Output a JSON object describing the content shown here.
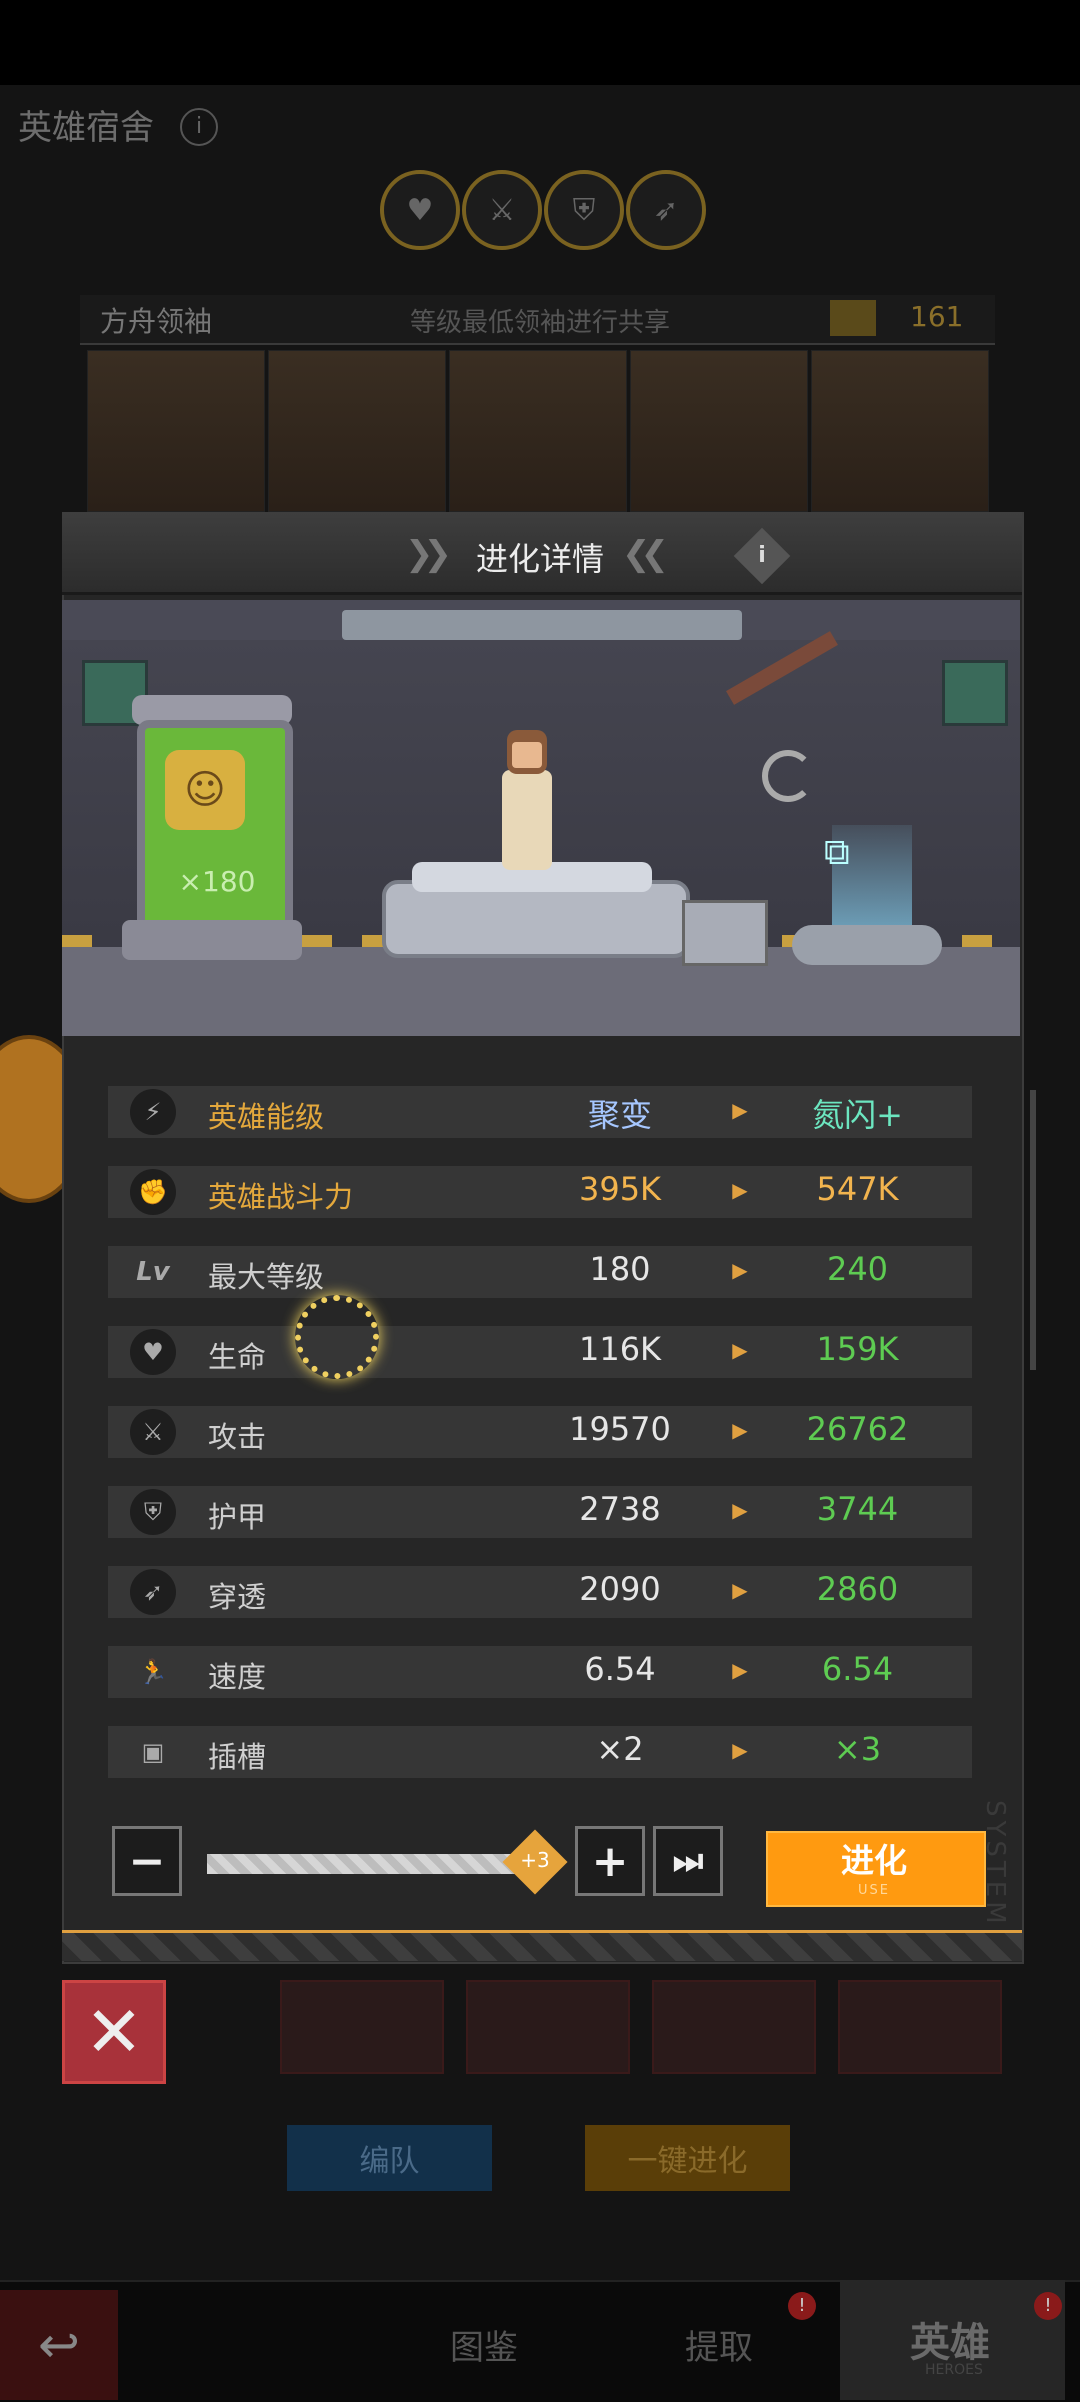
{
  "background": {
    "page_title": "英雄宿舍",
    "info_glyph": "i",
    "role_icons": [
      "heart-icon",
      "sword-icon",
      "shield-icon",
      "pierce-icon"
    ],
    "leader_label": "方舟领袖",
    "leader_desc": "等级最低领袖进行共享",
    "leader_level": "161",
    "team_button": "编队",
    "auto_evolve_button": "一键进化",
    "nav": {
      "codex": "图鉴",
      "extract": "提取",
      "heroes": "英雄",
      "heroes_sub": "HEROES",
      "badge": "!"
    }
  },
  "modal": {
    "title": "进化详情",
    "info_glyph": "i",
    "tube_count": "×180",
    "stats": [
      {
        "icon": "lightning-icon",
        "label": "英雄能级",
        "current": "聚变",
        "next": "氮闪+"
      },
      {
        "icon": "fist-icon",
        "label": "英雄战斗力",
        "current": "395K",
        "next": "547K"
      },
      {
        "icon": "level-icon",
        "label": "最大等级",
        "current": "180",
        "next": "240"
      },
      {
        "icon": "heart-icon",
        "label": "生命",
        "current": "116K",
        "next": "159K"
      },
      {
        "icon": "sword-icon",
        "label": "攻击",
        "current": "19570",
        "next": "26762"
      },
      {
        "icon": "shield-icon",
        "label": "护甲",
        "current": "2738",
        "next": "3744"
      },
      {
        "icon": "pierce-icon",
        "label": "穿透",
        "current": "2090",
        "next": "2860"
      },
      {
        "icon": "run-icon",
        "label": "速度",
        "current": "6.54",
        "next": "6.54"
      },
      {
        "icon": "chip-icon",
        "label": "插槽",
        "current": "×2",
        "next": "×3"
      }
    ],
    "arrow_glyph": "▶",
    "level_glyph": "Lv",
    "controls": {
      "minus": "−",
      "plus": "+",
      "max": "⏭",
      "slider_value_label": "+3",
      "slider_fraction": 1.0,
      "evolve_label": "进化",
      "evolve_sub": "USE"
    },
    "side_text": "SYSTEM"
  },
  "colors": {
    "accent": "#ff9a10",
    "gold_text": "#f2b44e",
    "green_text": "#5ecc52",
    "cyan_text": "#6ce6c0",
    "blue_text": "#a6c7ff"
  }
}
